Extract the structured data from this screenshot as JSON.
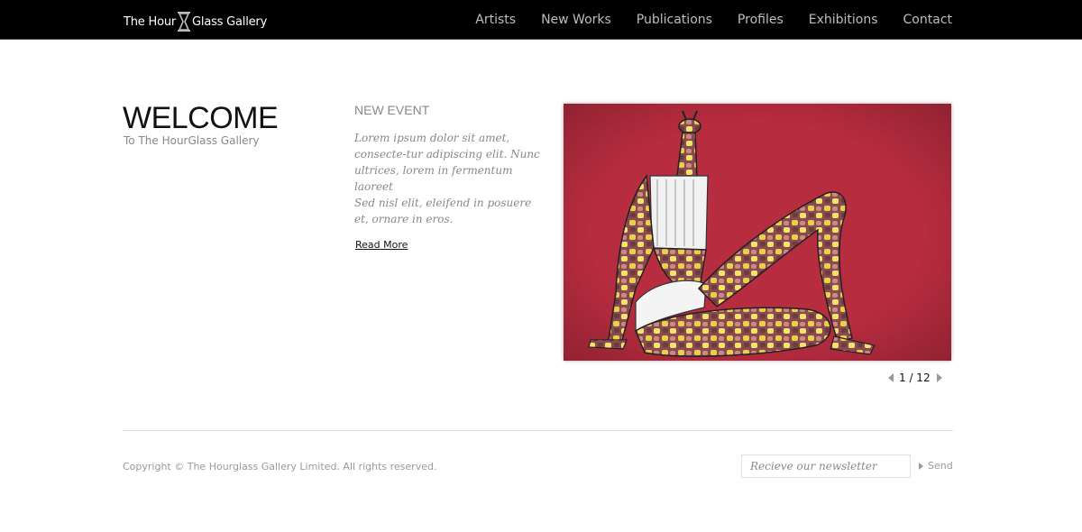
{
  "header": {
    "logo_left": "The Hour",
    "logo_right": "Glass Gallery",
    "nav": [
      "Artists",
      "New Works",
      "Publications",
      "Profiles",
      "Exhibitions",
      "Contact"
    ]
  },
  "welcome": {
    "title": "WELCOME",
    "subtitle": "To The HourGlass Gallery"
  },
  "event": {
    "title": "NEW EVENT",
    "paragraph1": "Lorem ipsum dolor sit amet, consecte-tur adipiscing elit. Nunc ultrices, lorem in fermentum laoreet",
    "paragraph2": "Sed nisl elit, eleifend in posuere et, ornare in eros.",
    "read_more": "Read More"
  },
  "slideshow": {
    "counter": "1 / 12",
    "background_color": "#b52b3c"
  },
  "footer": {
    "copyright": "Copyright © The Hourglass Gallery Limited. All rights reserved.",
    "newsletter_placeholder": "Recieve our newsletter",
    "send_label": "Send"
  }
}
